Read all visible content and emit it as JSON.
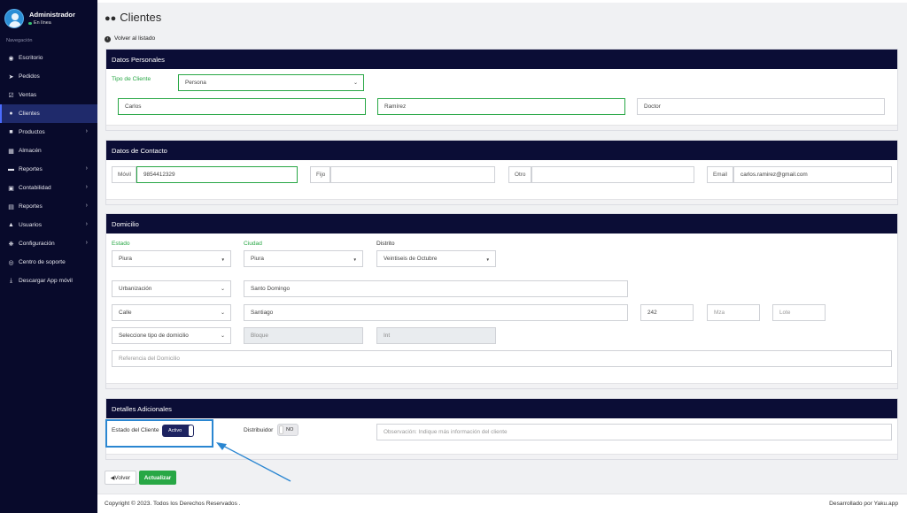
{
  "user": {
    "name": "Administrador",
    "status": "En línea"
  },
  "nav": {
    "section": "Navegación",
    "items": [
      {
        "label": "Escritorio",
        "icon": "dashboard-icon"
      },
      {
        "label": "Pedidos",
        "icon": "paper-plane-icon"
      },
      {
        "label": "Ventas",
        "icon": "check-square-icon"
      },
      {
        "label": "Clientes",
        "icon": "users-icon",
        "active": true
      },
      {
        "label": "Productos",
        "icon": "box-icon",
        "expandable": true
      },
      {
        "label": "Almacén",
        "icon": "warehouse-icon"
      },
      {
        "label": "Reportes",
        "icon": "truck-icon",
        "expandable": true
      },
      {
        "label": "Contabilidad",
        "icon": "ledger-icon",
        "expandable": true
      },
      {
        "label": "Reportes",
        "icon": "chart-icon",
        "expandable": true
      },
      {
        "label": "Usuarios",
        "icon": "user-icon",
        "expandable": true
      },
      {
        "label": "Configuración",
        "icon": "cogs-icon",
        "expandable": true
      },
      {
        "label": "Centro de soporte",
        "icon": "lifebuoy-icon"
      },
      {
        "label": "Descargar App móvil",
        "icon": "download-icon"
      }
    ]
  },
  "page": {
    "title": "Clientes",
    "back_link": "Volver al listado"
  },
  "personal": {
    "header": "Datos Personales",
    "client_type_label": "Tipo de Cliente",
    "client_type_value": "Persona",
    "first_name": "Carlos",
    "last_name": "Ramírez",
    "title_value": "Doctor"
  },
  "contact": {
    "header": "Datos de Contacto",
    "mobile_label": "Móvil",
    "mobile_value": "9854412329",
    "phone_label": "Fijo",
    "phone_value": "",
    "other_label": "Otro",
    "other_value": "",
    "email_label": "Email",
    "email_value": "carlos.ramirez@gmail.com"
  },
  "address": {
    "header": "Domicilio",
    "state_label": "Estado",
    "state_value": "Piura",
    "city_label": "Ciudad",
    "city_value": "Piura",
    "district_label": "Distrito",
    "district_value": "Veintiseis de Octubre",
    "zone_type": "Urbanización",
    "zone_name": "Santo Domingo",
    "street_type": "Calle",
    "street_name": "Santiago",
    "number": "242",
    "block_placeholder": "Mza",
    "lot_placeholder": "Lote",
    "home_type": "Seleccione tipo de domicilio",
    "building_placeholder": "Bloque",
    "interior_placeholder": "Int",
    "reference_placeholder": "Referencia del Domicilio"
  },
  "extra": {
    "header": "Detalles Adicionales",
    "status_label": "Estado del Cliente",
    "status_value": "Activo",
    "distributor_label": "Distribuidor",
    "distributor_value": "NO",
    "notes_placeholder": "Observación: Indique más información del cliente"
  },
  "actions": {
    "back_label": "Volver",
    "save_label": "Actualizar"
  },
  "footer": {
    "copyright": "Copyright © 2023. Todos los Derechos Reservados .",
    "credit": "Desarrollado por Yaku.app"
  },
  "colors": {
    "sidebar": "#080a2b",
    "header": "#0b0d36",
    "accent_green": "#28a745",
    "annotation_blue": "#2a86d1"
  }
}
